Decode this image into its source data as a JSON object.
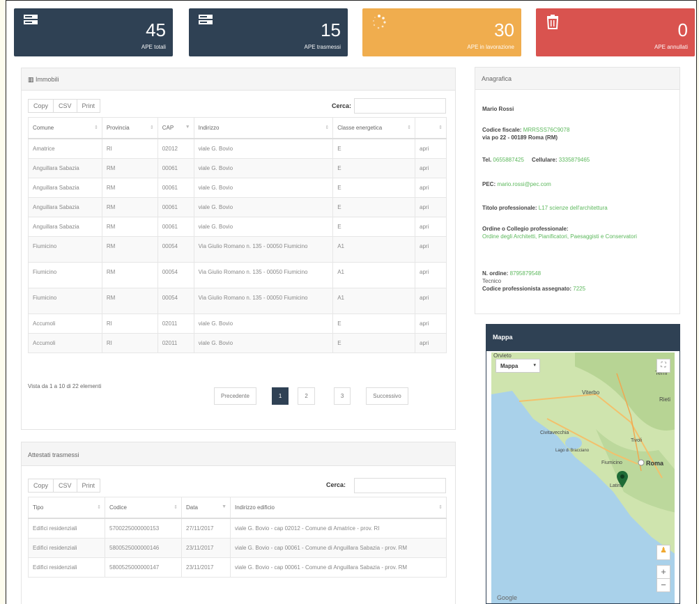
{
  "tiles": [
    {
      "value": "45",
      "label": "APE totali",
      "icon": "server-icon",
      "color": "#2f4154"
    },
    {
      "value": "15",
      "label": "APE trasmessi",
      "icon": "server-icon",
      "color": "#2f4154"
    },
    {
      "value": "30",
      "label": "APE in lavorazione",
      "icon": "spinner-icon",
      "color": "#f0ad4e"
    },
    {
      "value": "0",
      "label": "APE annullati",
      "icon": "trash-icon",
      "color": "#d9534f"
    }
  ],
  "immobili": {
    "title": "Immobili",
    "buttons": [
      "Copy",
      "CSV",
      "Print"
    ],
    "search_label": "Cerca:",
    "columns": [
      "Comune",
      "Provincia",
      "CAP",
      "Indirizzo",
      "Classe energetica",
      ""
    ],
    "rows": [
      [
        "Amatrice",
        "RI",
        "02012",
        "viale G. Bovio",
        "E",
        "apri"
      ],
      [
        "Anguillara Sabazia",
        "RM",
        "00061",
        "viale G. Bovio",
        "E",
        "apri"
      ],
      [
        "Anguillara Sabazia",
        "RM",
        "00061",
        "viale G. Bovio",
        "E",
        "apri"
      ],
      [
        "Anguillara Sabazia",
        "RM",
        "00061",
        "viale G. Bovio",
        "E",
        "apri"
      ],
      [
        "Anguillara Sabazia",
        "RM",
        "00061",
        "viale G. Bovio",
        "E",
        "apri"
      ],
      [
        "Fiumicino",
        "RM",
        "00054",
        "Via Giulio Romano n. 135 - 00050 Fiumicino",
        "A1",
        "apri"
      ],
      [
        "Fiumicino",
        "RM",
        "00054",
        "Via Giulio Romano n. 135 - 00050 Fiumicino",
        "A1",
        "apri"
      ],
      [
        "Fiumicino",
        "RM",
        "00054",
        "Via Giulio Romano n. 135 - 00050 Fiumicino",
        "A1",
        "apri"
      ],
      [
        "Accumoli",
        "RI",
        "02011",
        "viale G. Bovio",
        "E",
        "apri"
      ],
      [
        "Accumoli",
        "RI",
        "02011",
        "viale G. Bovio",
        "E",
        "apri"
      ]
    ],
    "info": "Vista da 1 a 10 di 22 elementi",
    "pager": {
      "prev": "Precedente",
      "pages": [
        "1",
        "2",
        "3"
      ],
      "next": "Successivo"
    }
  },
  "attestati": {
    "title": "Attestati trasmessi",
    "buttons": [
      "Copy",
      "CSV",
      "Print"
    ],
    "search_label": "Cerca:",
    "columns": [
      "Tipo",
      "Codice",
      "Data",
      "Indirizzo edificio"
    ],
    "rows": [
      [
        "Edifici residenziali",
        "5700225000000153",
        "27/11/2017",
        "viale G. Bovio - cap 02012 - Comune di Amatrice - prov. RI"
      ],
      [
        "Edifici residenziali",
        "5800525000000146",
        "23/11/2017",
        "viale G. Bovio - cap 00061 - Comune di Anguillara Sabazia - prov. RM"
      ],
      [
        "Edifici residenziali",
        "5800525000000147",
        "23/11/2017",
        "viale G. Bovio - cap 00061 - Comune di Anguillara Sabazia - prov. RM"
      ]
    ]
  },
  "anagrafica": {
    "title": "Anagrafica",
    "name": "Mario Rossi",
    "cf_label": "Codice fiscale:",
    "cf_value": "MRRSSS76C9078",
    "address": "via po 22 - 00189 Roma (RM)",
    "tel_label": "Tel.",
    "tel_value": "0655887425",
    "cell_label": "Cellulare:",
    "cell_value": "3335879465",
    "pec_label": "PEC:",
    "pec_value": "mario.rossi@pec.com",
    "titolo_label": "Titolo professionale:",
    "titolo_value": "L17 scienze dell'architettura",
    "ordine_label": "Ordine o Collegio professionale:",
    "ordine_value": "Ordine degli Architetti, Pianificatori, Paesaggisti e Conservatori",
    "nordine_label": "N. ordine:",
    "nordine_value": "8795879548",
    "ruolo": "Tecnico",
    "codice_label": "Codice professionista assegnato:",
    "codice_value": "7225"
  },
  "mappa": {
    "title": "Mappa",
    "type_select": "Mappa",
    "labels": [
      "Orvieto",
      "Viterbo",
      "Terni",
      "Rieti",
      "Civitavecchia",
      "Roma",
      "Fiumicino",
      "Lago di Bracciano",
      "Latina",
      "Tivoli"
    ],
    "google": "Google"
  }
}
